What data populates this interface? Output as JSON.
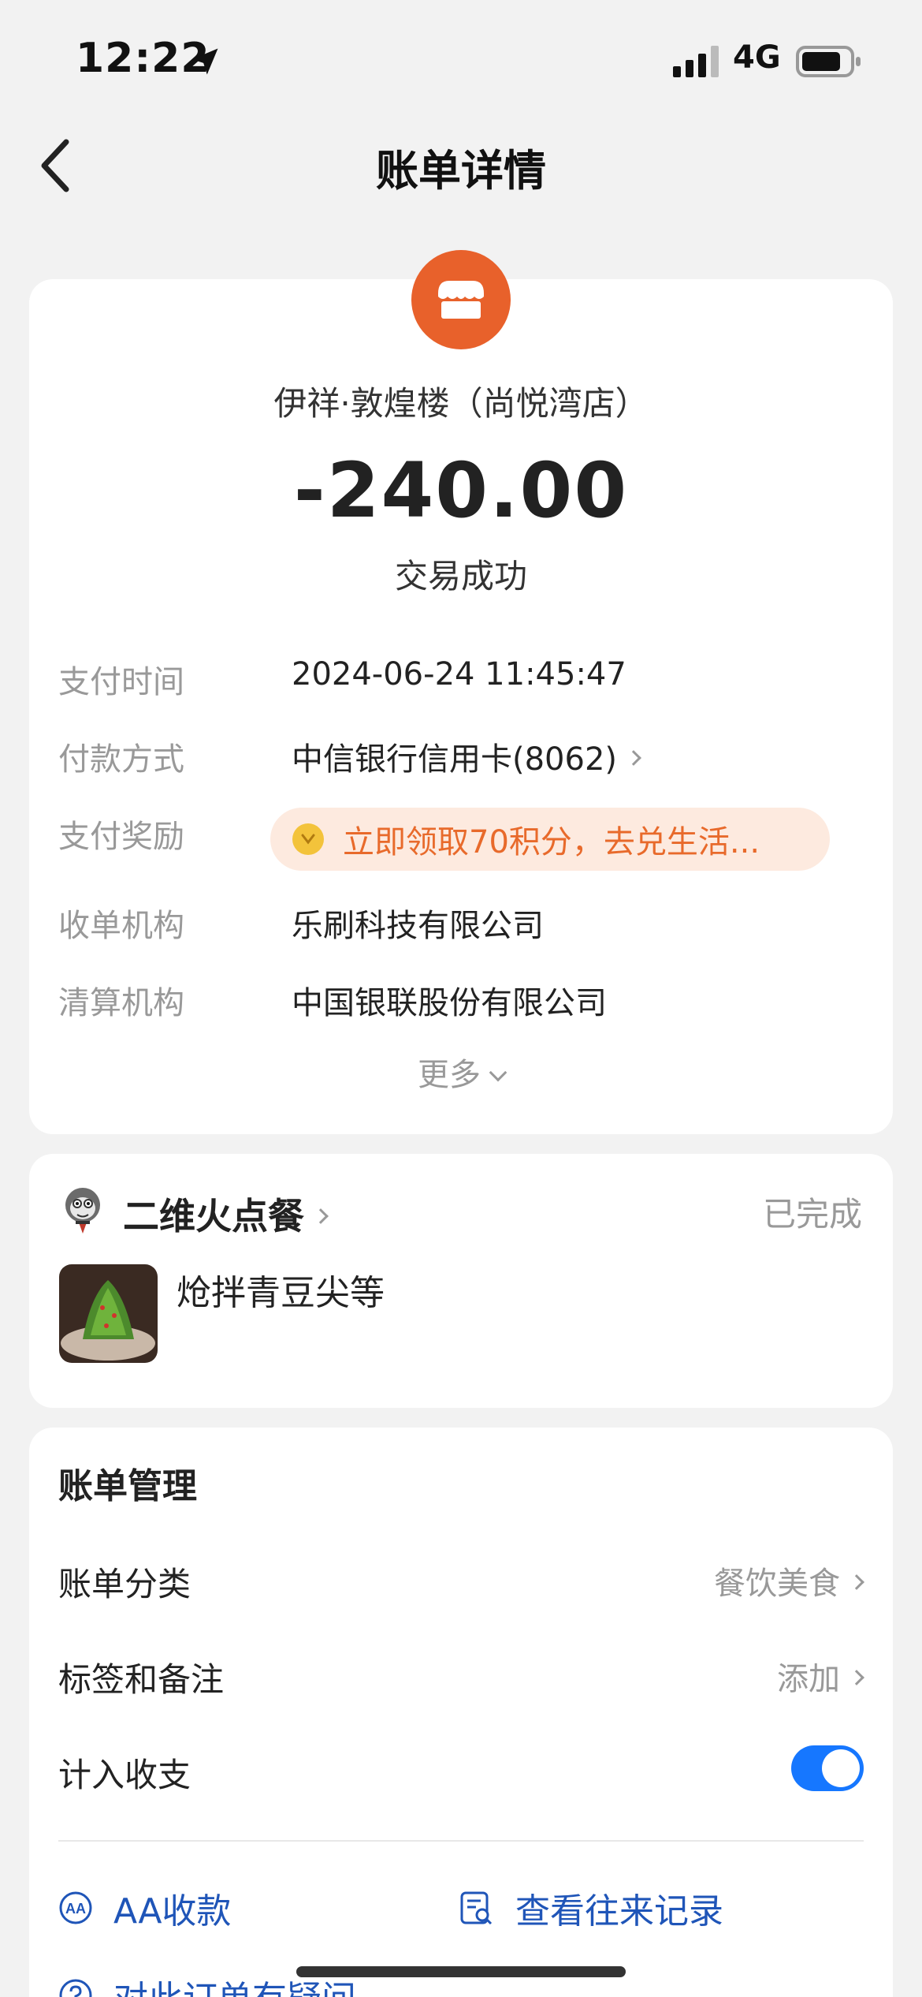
{
  "status_bar": {
    "time": "12:22",
    "network": "4G"
  },
  "nav": {
    "title": "账单详情"
  },
  "summary": {
    "merchant_name": "伊祥·敦煌楼（尚悦湾店）",
    "amount": "-240.00",
    "status": "交易成功",
    "logo_color": "#e8612b"
  },
  "details": {
    "pay_time_label": "支付时间",
    "pay_time": "2024-06-24 11:45:47",
    "pay_method_label": "付款方式",
    "pay_method": "中信银行信用卡(8062)",
    "reward_label": "支付奖励",
    "reward_text": "立即领取70积分，去兑生活...",
    "acquirer_label": "收单机构",
    "acquirer": "乐刷科技有限公司",
    "clearing_label": "清算机构",
    "clearing": "中国银联股份有限公司",
    "more": "更多"
  },
  "order": {
    "source": "二维火点餐",
    "status": "已完成",
    "dish": "炝拌青豆尖等"
  },
  "management": {
    "title": "账单管理",
    "category_label": "账单分类",
    "category_value": "餐饮美食",
    "tags_label": "标签和备注",
    "tags_value": "添加",
    "include_label": "计入收支",
    "include_enabled": true,
    "aa_label": "AA收款",
    "history_label": "查看往来记录",
    "question_label": "对此订单有疑问"
  },
  "colors": {
    "accent": "#1677ff",
    "link": "#1f55b8",
    "reward_bg": "#fdeadf",
    "reward_text": "#e86a2b"
  }
}
